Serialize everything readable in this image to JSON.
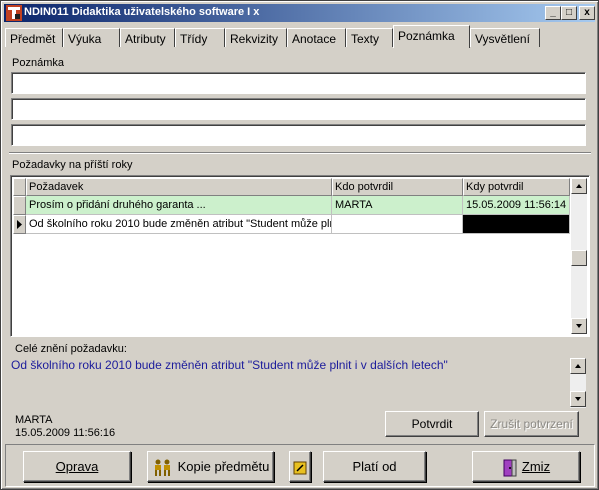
{
  "window": {
    "title": "NDIN011 Didaktika uživatelského software I x",
    "buttons": {
      "minimize": "_",
      "maximize": "□",
      "close": "x"
    }
  },
  "tabs": [
    {
      "label": "Předmět",
      "active": false
    },
    {
      "label": "Výuka",
      "active": false
    },
    {
      "label": "Atributy",
      "active": false
    },
    {
      "label": "Třídy",
      "active": false
    },
    {
      "label": "Rekvizity",
      "active": false
    },
    {
      "label": "Anotace",
      "active": false
    },
    {
      "label": "Texty",
      "active": false
    },
    {
      "label": "Poznámka",
      "active": true
    },
    {
      "label": "Vysvětlení",
      "active": false
    }
  ],
  "note": {
    "label": "Poznámka",
    "lines": [
      "",
      "",
      ""
    ]
  },
  "requests": {
    "label": "Požadavky na příští roky",
    "columns": [
      "Požadavek",
      "Kdo potvrdil",
      "Kdy potvrdil"
    ],
    "rows": [
      {
        "request": "Prosím o přidání druhého garanta ...",
        "confirmed_by": "MARTA",
        "confirmed_at": "15.05.2009 11:56:14",
        "state": "confirmed"
      },
      {
        "request": "Od školního roku 2010 bude změněn atribut \"Student může pln",
        "confirmed_by": "",
        "confirmed_at": "",
        "state": "current"
      }
    ]
  },
  "detail": {
    "label": "Celé znění požadavku:",
    "text": "Od školního roku 2010 bude změněn atribut \"Student může plnit i v dalších letech\"",
    "author": "MARTA",
    "timestamp": "15.05.2009 11:56:16",
    "confirm_label": "Potvrdit",
    "cancel_confirm_label": "Zrušit potvrzení"
  },
  "bottom": {
    "oprava": "Oprava",
    "kopie": "Kopie předmětu",
    "plati_od": "Platí od",
    "zmiz": "Zmiz"
  },
  "colors": {
    "title_start": "#0a246a",
    "title_end": "#a6caf0",
    "confirmed_row": "#ccf0cc",
    "detail_text": "#1c1c9c",
    "face": "#d4d0c8"
  }
}
